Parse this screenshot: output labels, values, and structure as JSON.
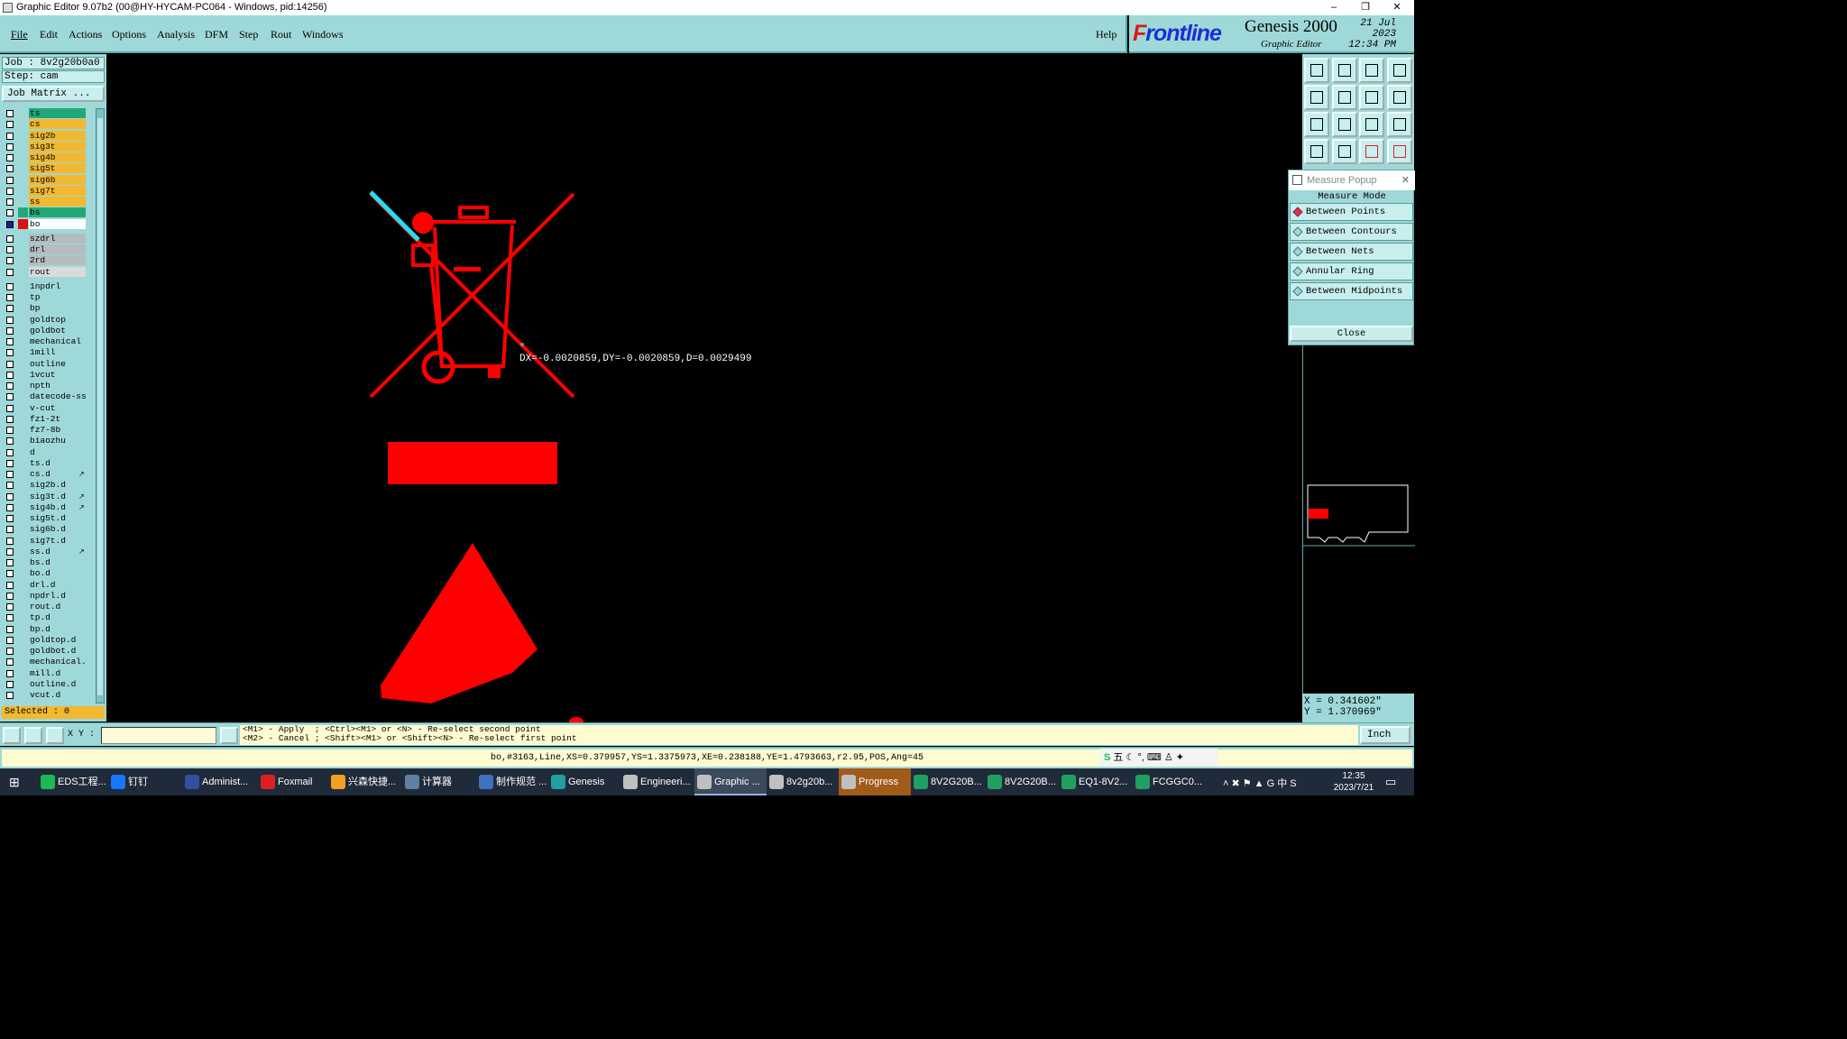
{
  "window": {
    "title": "Graphic Editor 9.07b2 (00@HY-HYCAM-PC064 - Windows, pid:14256)",
    "controls": [
      "–",
      "❐",
      "✕"
    ]
  },
  "menu": [
    "File",
    "Edit",
    "Actions",
    "Options",
    "Analysis",
    "DFM",
    "Step",
    "Rout",
    "Windows"
  ],
  "help": "Help",
  "brand": {
    "logo_f": "F",
    "logo_rest": "rontline",
    "product": "Genesis 2000",
    "subtitle": "Graphic Editor",
    "date": "21 Jul 2023",
    "time": "12:34 PM"
  },
  "job": {
    "job": "Job : 8v2g20b0a0",
    "step": "Step: cam",
    "matrix_button": "Job Matrix ..."
  },
  "layers": [
    {
      "name": "ts",
      "color": "#22a878"
    },
    {
      "name": "cs",
      "color": "#f2b830"
    },
    {
      "name": "sig2b",
      "color": "#f2b830"
    },
    {
      "name": "sig3t",
      "color": "#f2b830"
    },
    {
      "name": "sig4b",
      "color": "#f2b830"
    },
    {
      "name": "sig5t",
      "color": "#f2b830"
    },
    {
      "name": "sig6b",
      "color": "#f2b830"
    },
    {
      "name": "sig7t",
      "color": "#f2b830"
    },
    {
      "name": "ss",
      "color": "#f2b830"
    },
    {
      "name": "bs",
      "color": "#22a878",
      "swatch": "#22a878"
    },
    {
      "name": "bo",
      "color": "#ffffff",
      "swatch": "#e01010",
      "active": true
    },
    {
      "name": "szdrl",
      "color": "#b4bcc0",
      "gap": true
    },
    {
      "name": "drl",
      "color": "#b4bcc0"
    },
    {
      "name": "2rd",
      "color": "#b4bcc0"
    },
    {
      "name": "rout",
      "color": "#dadada"
    },
    {
      "name": "1npdrl",
      "color": "#9fd8d8",
      "gap": true
    },
    {
      "name": "tp",
      "color": "#9fd8d8"
    },
    {
      "name": "bp",
      "color": "#9fd8d8"
    },
    {
      "name": "goldtop",
      "color": "#9fd8d8"
    },
    {
      "name": "goldbot",
      "color": "#9fd8d8"
    },
    {
      "name": "mechanical",
      "color": "#9fd8d8"
    },
    {
      "name": "1mill",
      "color": "#9fd8d8"
    },
    {
      "name": "outline",
      "color": "#9fd8d8"
    },
    {
      "name": "1vcut",
      "color": "#9fd8d8"
    },
    {
      "name": "npth",
      "color": "#9fd8d8"
    },
    {
      "name": "datecode-ss",
      "color": "#9fd8d8"
    },
    {
      "name": "v-cut",
      "color": "#9fd8d8"
    },
    {
      "name": "fz1-2t",
      "color": "#9fd8d8"
    },
    {
      "name": "fz7-8b",
      "color": "#9fd8d8"
    },
    {
      "name": "biaozhu",
      "color": "#9fd8d8"
    },
    {
      "name": "d",
      "color": "#9fd8d8"
    },
    {
      "name": "ts.d",
      "color": "#9fd8d8"
    },
    {
      "name": "cs.d",
      "color": "#9fd8d8",
      "mark": "↗"
    },
    {
      "name": "sig2b.d",
      "color": "#9fd8d8"
    },
    {
      "name": "sig3t.d",
      "color": "#9fd8d8",
      "mark": "↗"
    },
    {
      "name": "sig4b.d",
      "color": "#9fd8d8",
      "mark": "↗"
    },
    {
      "name": "sig5t.d",
      "color": "#9fd8d8"
    },
    {
      "name": "sig6b.d",
      "color": "#9fd8d8"
    },
    {
      "name": "sig7t.d",
      "color": "#9fd8d8"
    },
    {
      "name": "ss.d",
      "color": "#9fd8d8",
      "mark": "↗"
    },
    {
      "name": "bs.d",
      "color": "#9fd8d8"
    },
    {
      "name": "bo.d",
      "color": "#9fd8d8"
    },
    {
      "name": "drl.d",
      "color": "#9fd8d8"
    },
    {
      "name": "npdrl.d",
      "color": "#9fd8d8"
    },
    {
      "name": "rout.d",
      "color": "#9fd8d8"
    },
    {
      "name": "tp.d",
      "color": "#9fd8d8"
    },
    {
      "name": "bp.d",
      "color": "#9fd8d8"
    },
    {
      "name": "goldtop.d",
      "color": "#9fd8d8"
    },
    {
      "name": "goldbot.d",
      "color": "#9fd8d8"
    },
    {
      "name": "mechanical.d",
      "color": "#9fd8d8"
    },
    {
      "name": "mill.d",
      "color": "#9fd8d8"
    },
    {
      "name": "outline.d",
      "color": "#9fd8d8"
    },
    {
      "name": "vcut.d",
      "color": "#9fd8d8"
    }
  ],
  "selected": "Selected : 0",
  "measure_popup": {
    "title": "Measure Popup",
    "close_x": "✕",
    "mode_label": "Measure Mode",
    "options": [
      "Between Points",
      "Between Contours",
      "Between Nets",
      "Annular Ring",
      "Between Midpoints"
    ],
    "selected_option": "Between Points",
    "close_button": "Close"
  },
  "canvas": {
    "measure_readout": "DX=-0.0020859,DY=-0.0020859,D=0.0029499",
    "feature_color": "#ff0000",
    "highlight_color": "#22e0f0"
  },
  "coords": {
    "x": "X = 0.341602\"",
    "y": "Y = 1.370969\""
  },
  "bottom": {
    "xy_label": "X Y :",
    "xy_value": "",
    "hint1": "<M1> - Apply  ; <Ctrl><M1> or <N> - Re-select second point",
    "hint2": "<M2> - Cancel ; <Shift><M1> or <Shift><N> - Re-select first point",
    "units": "Inch"
  },
  "status": "bo,#3163,Line,XS=0.379957,YS=1.3375973,XE=0.238188,YE=1.4793663,r2.95,POS,Ang=45",
  "ime": "五 ☾ °, ⌨ ♙ ✦",
  "taskbar": {
    "items": [
      {
        "label": "EDS工程...",
        "color": "#1db954"
      },
      {
        "label": "钉钉",
        "color": "#1677ff"
      },
      {
        "label": "Administ...",
        "color": "#3050a0"
      },
      {
        "label": "Foxmail",
        "color": "#e02020"
      },
      {
        "label": "兴森快捷...",
        "color": "#f2a020"
      },
      {
        "label": "计算器",
        "color": "#6080a0"
      },
      {
        "label": "制作规范 ...",
        "color": "#4070c0"
      },
      {
        "label": "Genesis",
        "color": "#20a0a0"
      },
      {
        "label": "Engineeri...",
        "color": "#c0c0c0"
      },
      {
        "label": "Graphic ...",
        "color": "#c0c0c0",
        "active": true
      },
      {
        "label": "8v2g20b...",
        "color": "#c0c0c0"
      },
      {
        "label": "Progress",
        "color": "#c0c0c0",
        "prog": true
      },
      {
        "label": "8V2G20B...",
        "color": "#20a060"
      },
      {
        "label": "8V2G20B...",
        "color": "#20a060"
      },
      {
        "label": "EQ1-8V2...",
        "color": "#20a060"
      },
      {
        "label": "FCGGC0...",
        "color": "#20a060"
      }
    ],
    "tray": "˄ ✖ ⚑ ▲ G 中 S",
    "time": "12:35",
    "date": "2023/7/21"
  }
}
